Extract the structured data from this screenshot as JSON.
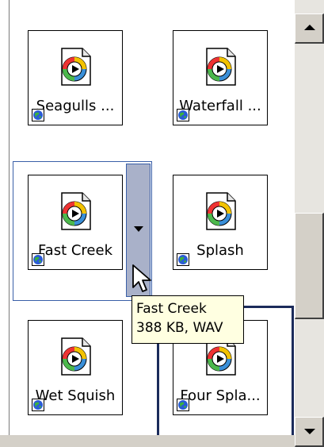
{
  "gallery": {
    "items": [
      {
        "label": "Seagulls ...",
        "icon": "sound-file-icon",
        "badge": "web-globe-icon"
      },
      {
        "label": "Waterfall ...",
        "icon": "sound-file-icon",
        "badge": "web-globe-icon"
      },
      {
        "label": "Fast Creek",
        "icon": "sound-file-icon",
        "badge": "web-globe-icon",
        "state": "selected"
      },
      {
        "label": "Splash",
        "icon": "sound-file-icon",
        "badge": "web-globe-icon"
      },
      {
        "label": "Wet Squish",
        "icon": "sound-file-icon",
        "badge": "web-globe-icon"
      },
      {
        "label": "Four Spla...",
        "icon": "sound-file-icon",
        "badge": "web-globe-icon",
        "state": "focused"
      }
    ],
    "dropdown_icon": "chevron-down-icon"
  },
  "tooltip": {
    "line1": "Fast Creek",
    "line2": "388 KB, WAV"
  },
  "scrollbar": {
    "up_icon": "arrow-up-icon",
    "down_icon": "arrow-down-icon"
  },
  "colors": {
    "selection_border": "#3a5fa8",
    "focus_border": "#1b2b5b",
    "dropdown_fill": "#a9b1c9",
    "tooltip_bg": "#ffffe1",
    "scrollbar_face": "#d4d0c8"
  }
}
